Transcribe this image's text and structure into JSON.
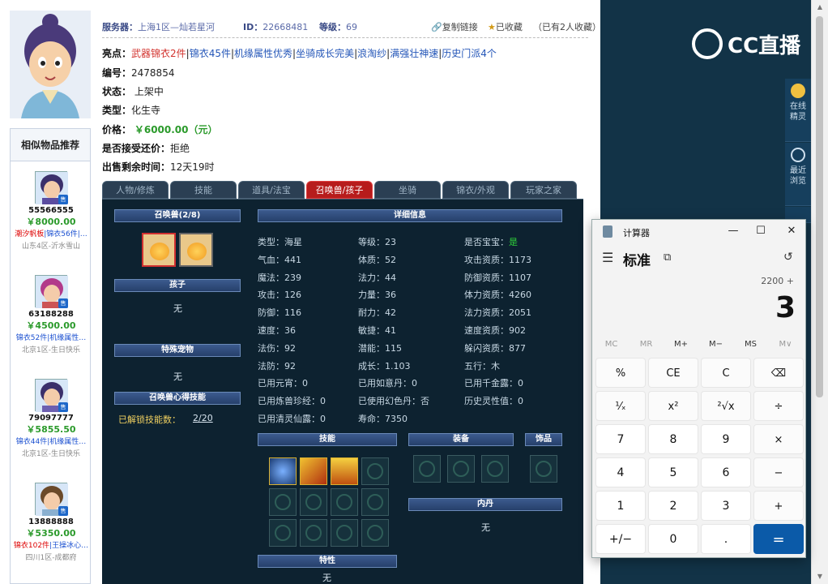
{
  "header": {
    "server_label": "服务器：",
    "server_value": "上海1区—灿若星河",
    "id_label": "ID：",
    "id_value": "22668481",
    "level_label": "等级：",
    "level_value": "69",
    "copy_link": "复制链接",
    "favorited": "已收藏",
    "fav_count": "（已有2人收藏）"
  },
  "info": {
    "highlights_label": "亮点：",
    "highlights": [
      "武器锦衣2件",
      "锦衣45件",
      "机缘属性优秀",
      "坐骑成长完美",
      "浪淘纱",
      "满强壮神速",
      "历史门派4个"
    ],
    "number_label": "编号：",
    "number_value": "2478854",
    "status_label": "状态：",
    "status_value": "上架中",
    "type_label": "类型：",
    "type_value": "化生寺",
    "price_label": "价格：",
    "price_value": "￥6000.00（元）",
    "bargain_label": "是否接受还价：",
    "bargain_value": "拒绝",
    "time_label": "出售剩余时间：",
    "time_value": "12天19时"
  },
  "sidebar": {
    "title": "相似物品推荐",
    "sale_tag": "售",
    "items": [
      {
        "id": "55566555",
        "price": "￥8000.00",
        "desc_red": "潮汐帆板",
        "desc_blue": "|锦衣56件|…",
        "server": "山东4区-沂水雪山"
      },
      {
        "id": "63188288",
        "price": "￥4500.00",
        "desc_red": "",
        "desc_blue": "锦衣52件|机缘属性…",
        "server": "北京1区-生日快乐"
      },
      {
        "id": "79097777",
        "price": "￥5855.50",
        "desc_red": "",
        "desc_blue": "锦衣44件|机缘属性…",
        "server": "北京1区-生日快乐"
      },
      {
        "id": "13888888",
        "price": "￥5350.00",
        "desc_red": "锦衣102件",
        "desc_blue": "|王操冰心…",
        "server": "四川1区-成都府"
      }
    ]
  },
  "tabs": [
    "人物/修炼",
    "技能",
    "道具/法宝",
    "召唤兽/孩子",
    "坐骑",
    "锦衣/外观",
    "玩家之家"
  ],
  "pet_panel": {
    "pets_title": "召唤兽(2/8)",
    "child_title": "孩子",
    "child_value": "无",
    "special_title": "特殊宠物",
    "special_value": "无",
    "skill_title": "召唤兽心得技能",
    "skill_unlock_label": "已解锁技能数：",
    "skill_unlock_value": "2/20",
    "detail_title": "详细信息",
    "skills_title": "技能",
    "equip_title": "装备",
    "accessory_title": "饰品",
    "core_title": "内丹",
    "core_value": "无",
    "trait_title": "特性",
    "trait_value": "无"
  },
  "attrs": [
    [
      "类型：海星",
      "等级：23",
      "是否宝宝：",
      "是"
    ],
    [
      "气血：441",
      "体质：52",
      "攻击资质：1173",
      ""
    ],
    [
      "魔法：239",
      "法力：44",
      "防御资质：1107",
      ""
    ],
    [
      "攻击：126",
      "力量：36",
      "体力资质：4260",
      ""
    ],
    [
      "防御：116",
      "耐力：42",
      "法力资质：2051",
      ""
    ],
    [
      "速度：36",
      "敏捷：41",
      "速度资质：902",
      ""
    ],
    [
      "法伤：92",
      "潜能：115",
      "躲闪资质：877",
      ""
    ],
    [
      "法防：92",
      "成长：1.103",
      "五行：木",
      ""
    ],
    [
      "已用元宵：0",
      "已用如意丹：0",
      "已用千金露：0",
      ""
    ],
    [
      "已用炼兽珍经：0",
      "已使用幻色丹：否",
      "历史灵性值：0",
      ""
    ],
    [
      "已用清灵仙露：0",
      "寿命：7350",
      "",
      ""
    ]
  ],
  "live": {
    "logo": "CC直播",
    "online_btn": "在线精灵",
    "recent_btn": "最近浏览"
  },
  "calculator": {
    "title": "计算器",
    "mode": "标准",
    "expression": "2200 +",
    "display": "3",
    "memory": [
      "MC",
      "MR",
      "M+",
      "M−",
      "MS",
      "M∨"
    ],
    "keys": [
      [
        "%",
        "CE",
        "C",
        "⌫"
      ],
      [
        "¹⁄ₓ",
        "x²",
        "²√x",
        "÷"
      ],
      [
        "7",
        "8",
        "9",
        "×"
      ],
      [
        "4",
        "5",
        "6",
        "−"
      ],
      [
        "1",
        "2",
        "3",
        "+"
      ],
      [
        "+/−",
        "0",
        ".",
        "="
      ]
    ]
  }
}
